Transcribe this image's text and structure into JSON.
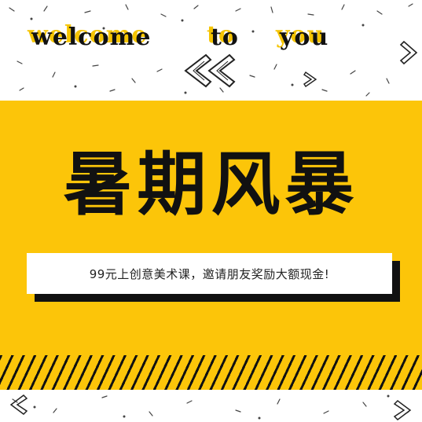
{
  "header": {
    "words": [
      "welcome",
      "to",
      "you"
    ],
    "chevron_icon": "double-chevron-left-icon"
  },
  "main": {
    "title": "暑期风暴",
    "subtitle": "99元上创意美术课，邀请朋友奖励大额现金!"
  },
  "colors": {
    "accent": "#fcc509",
    "text": "#111111",
    "background": "#ffffff"
  }
}
